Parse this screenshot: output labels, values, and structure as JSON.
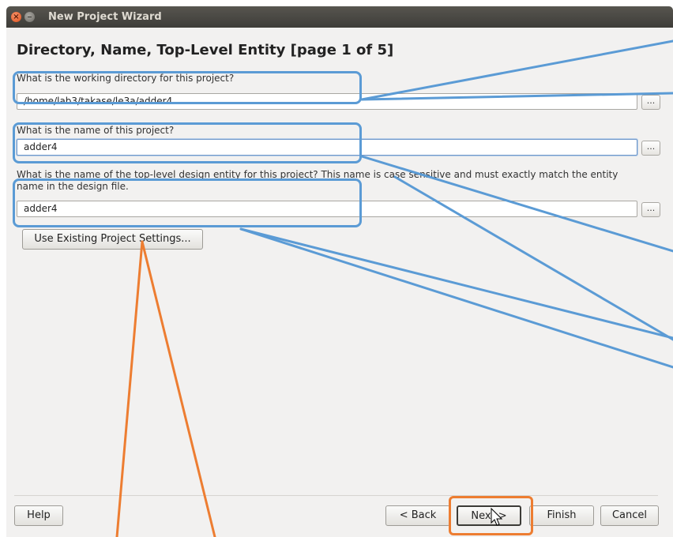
{
  "window": {
    "title": "New Project Wizard"
  },
  "page": {
    "heading": "Directory, Name, Top-Level Entity [page 1 of 5]"
  },
  "fields": [
    {
      "label": "What is the working directory for this project?",
      "value": "/home/lab3/takase/le3a/adder4",
      "browse_label": "..."
    },
    {
      "label": "What is the name of this project?",
      "value": "adder4",
      "browse_label": "..."
    },
    {
      "label": "What is the name of the top-level design entity for this project? This name is case sensitive and must exactly match the entity name in the design file.",
      "value": "adder4",
      "browse_label": "..."
    }
  ],
  "buttons": {
    "use_existing": "Use Existing Project Settings...",
    "help": "Help",
    "back": "< Back",
    "next": "Next >",
    "finish": "Finish",
    "cancel": "Cancel"
  },
  "colors": {
    "highlight_blue": "#5b9bd5",
    "highlight_orange": "#ed7d31"
  }
}
